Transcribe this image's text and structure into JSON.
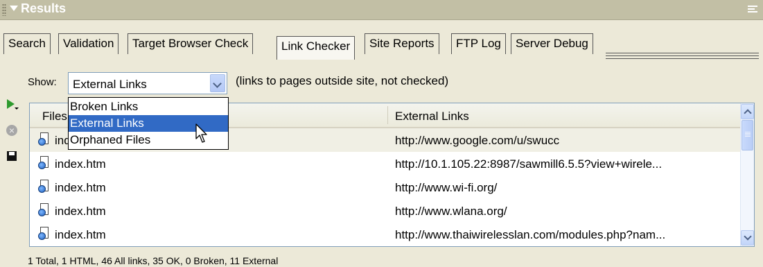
{
  "panel": {
    "title": "Results"
  },
  "tabs": [
    {
      "label": "Search",
      "active": false
    },
    {
      "label": "Validation",
      "active": false
    },
    {
      "label": "Target Browser Check",
      "active": false
    },
    {
      "label": "Link Checker",
      "active": true
    },
    {
      "label": "Site Reports",
      "active": false
    },
    {
      "label": "FTP Log",
      "active": false
    },
    {
      "label": "Server Debug",
      "active": false
    }
  ],
  "show": {
    "label": "Show:",
    "selected": "External Links",
    "description": "(links to pages outside site, not checked)",
    "options": [
      "Broken Links",
      "External Links",
      "Orphaned Files"
    ]
  },
  "tools": [
    "play-icon",
    "stop-icon",
    "save-icon"
  ],
  "table": {
    "columns": [
      "Files",
      "External Links"
    ],
    "rows": [
      {
        "file": "index.htm",
        "link": "http://www.google.com/u/swucc"
      },
      {
        "file": "index.htm",
        "link": "http://10.1.105.22:8987/sawmill6.5.5?view+wirele..."
      },
      {
        "file": "index.htm",
        "link": "http://www.wi-fi.org/"
      },
      {
        "file": "index.htm",
        "link": "http://www.wlana.org/"
      },
      {
        "file": "index.htm",
        "link": "http://www.thaiwirelesslan.com/modules.php?nam..."
      }
    ]
  },
  "status": "1 Total, 1 HTML, 46 All links, 35 OK, 0 Broken, 11 External",
  "colors": {
    "titlebar": "#c2bfa5",
    "selection": "#316ac5",
    "panel": "#ece9d8"
  }
}
